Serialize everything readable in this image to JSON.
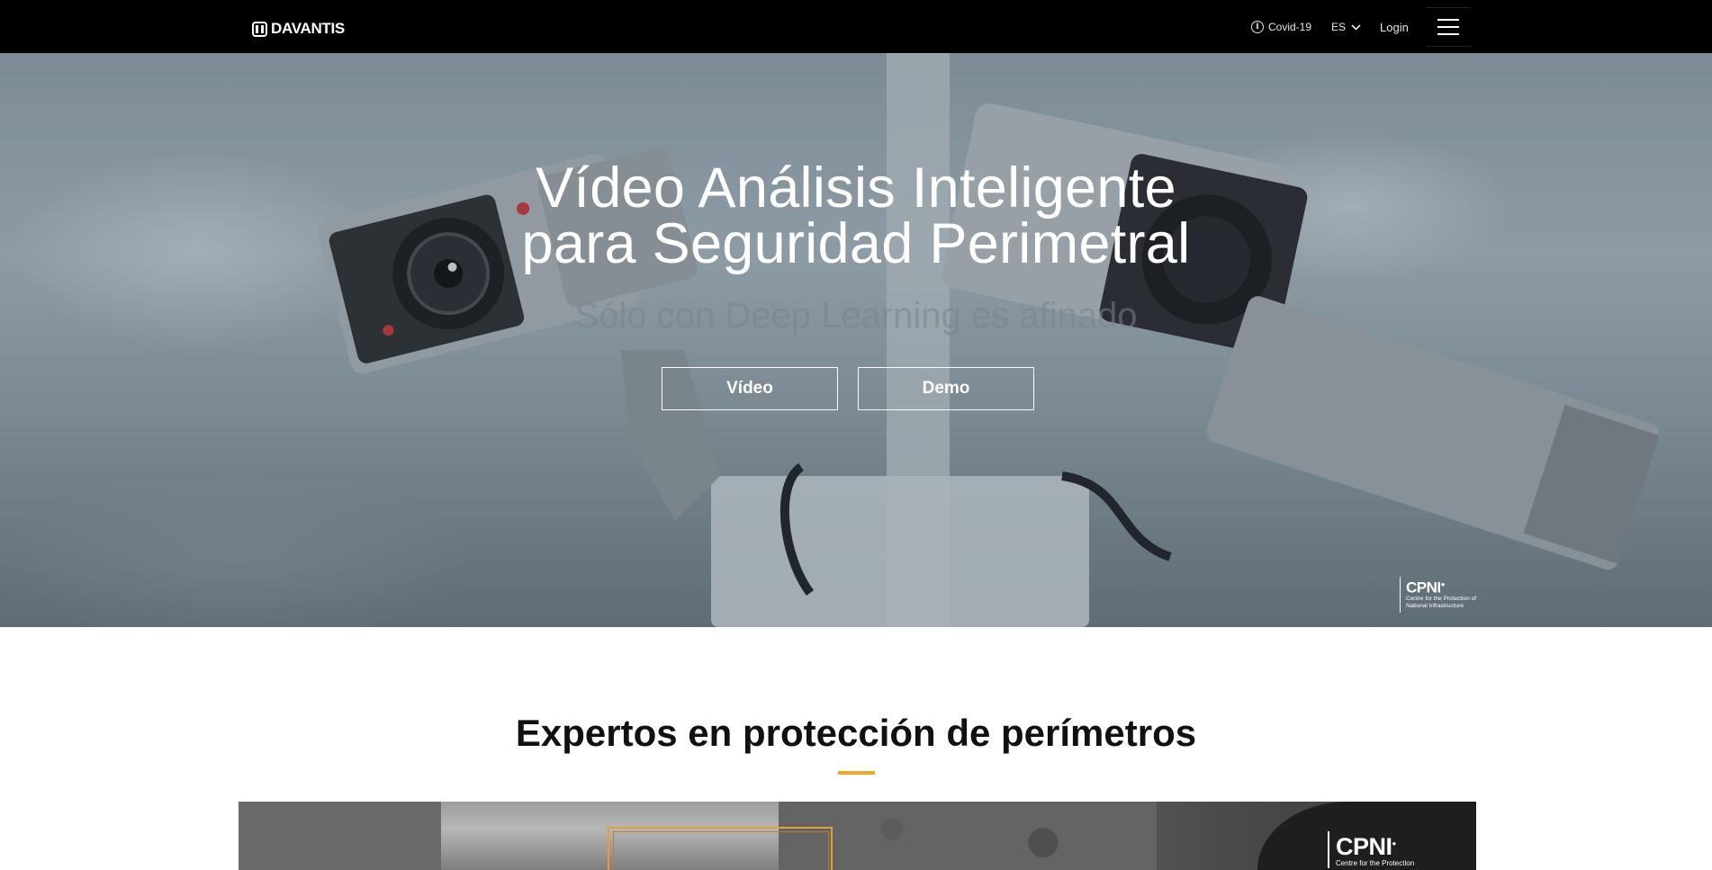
{
  "navbar": {
    "logo_text": "DAVANTIS",
    "covid_label": "Covid-19",
    "language": "ES",
    "login_label": "Login",
    "icons": [
      "davantis-logo-icon",
      "info-icon",
      "chevron-down-icon",
      "hamburger-menu-icon"
    ]
  },
  "hero": {
    "title_line1": "Vídeo Análisis Inteligente",
    "title_line2": "para Seguridad Perimetral",
    "subtitle": "Sólo con Deep Learning es afinado",
    "buttons": {
      "video": "Vídeo",
      "demo": "Demo"
    },
    "badge": {
      "name": "CPNI",
      "description": "Centre for the Protection of National Infrastructure"
    }
  },
  "section": {
    "title": "Expertos en protección de perímetros",
    "accent_color": "#f5a623",
    "image_badge": {
      "name": "CPNI",
      "description": "Centre for the Protection"
    }
  }
}
